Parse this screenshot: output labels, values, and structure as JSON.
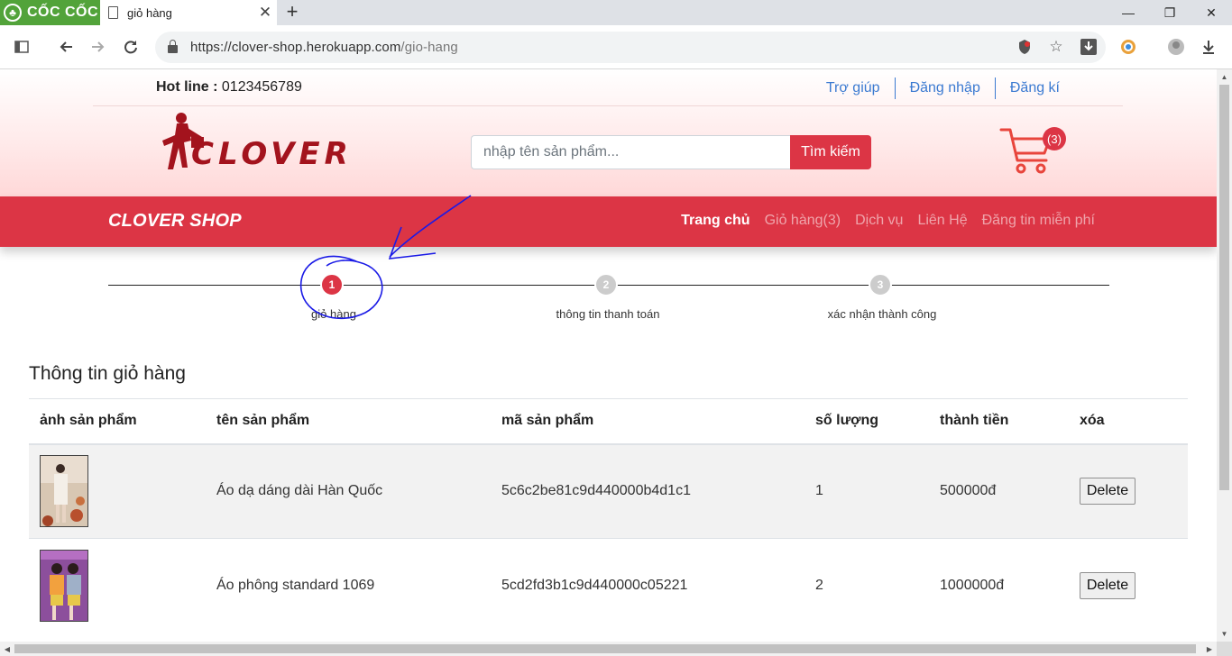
{
  "browser": {
    "brand": "CỐC CỐC",
    "tab_title": "giỏ hàng",
    "new_tab": "+",
    "url_host": "https://clover-shop.herokuapp.com",
    "url_path": "/gio-hang"
  },
  "header": {
    "hotline_label": "Hot line :",
    "hotline_number": "0123456789",
    "links": [
      "Trợ giúp",
      "Đăng nhập",
      "Đăng kí"
    ],
    "logo_text": "CLOVER",
    "search_placeholder": "nhập tên sản phẩm...",
    "search_button": "Tìm kiếm",
    "cart_count": "(3)"
  },
  "navbar": {
    "brand": "CLOVER SHOP",
    "links": [
      "Trang chủ",
      "Giỏ hàng(3)",
      "Dịch vụ",
      "Liên Hệ",
      "Đăng tin miễn phí"
    ]
  },
  "stepper": {
    "steps": [
      {
        "number": "1",
        "label": "giỏ hàng"
      },
      {
        "number": "2",
        "label": "thông tin thanh toán"
      },
      {
        "number": "3",
        "label": "xác nhận thành công"
      }
    ]
  },
  "cart": {
    "title": "Thông tin giỏ hàng",
    "columns": [
      "ảnh sản phẩm",
      "tên sản phẩm",
      "mã sản phẩm",
      "số lượng",
      "thành tiền",
      "xóa"
    ],
    "rows": [
      {
        "name": "Áo dạ dáng dài Hàn Quốc",
        "code": "5c6c2be81c9d440000b4d1c1",
        "qty": "1",
        "total": "500000đ",
        "delete": "Delete"
      },
      {
        "name": "Áo phông standard 1069",
        "code": "5cd2fd3b1c9d440000c05221",
        "qty": "2",
        "total": "1000000đ",
        "delete": "Delete"
      }
    ]
  },
  "colors": {
    "brand_red": "#dc3545",
    "logo_red": "#a3131d",
    "link_blue": "#3b7ad1",
    "annotation_blue": "#1a1ae6"
  }
}
